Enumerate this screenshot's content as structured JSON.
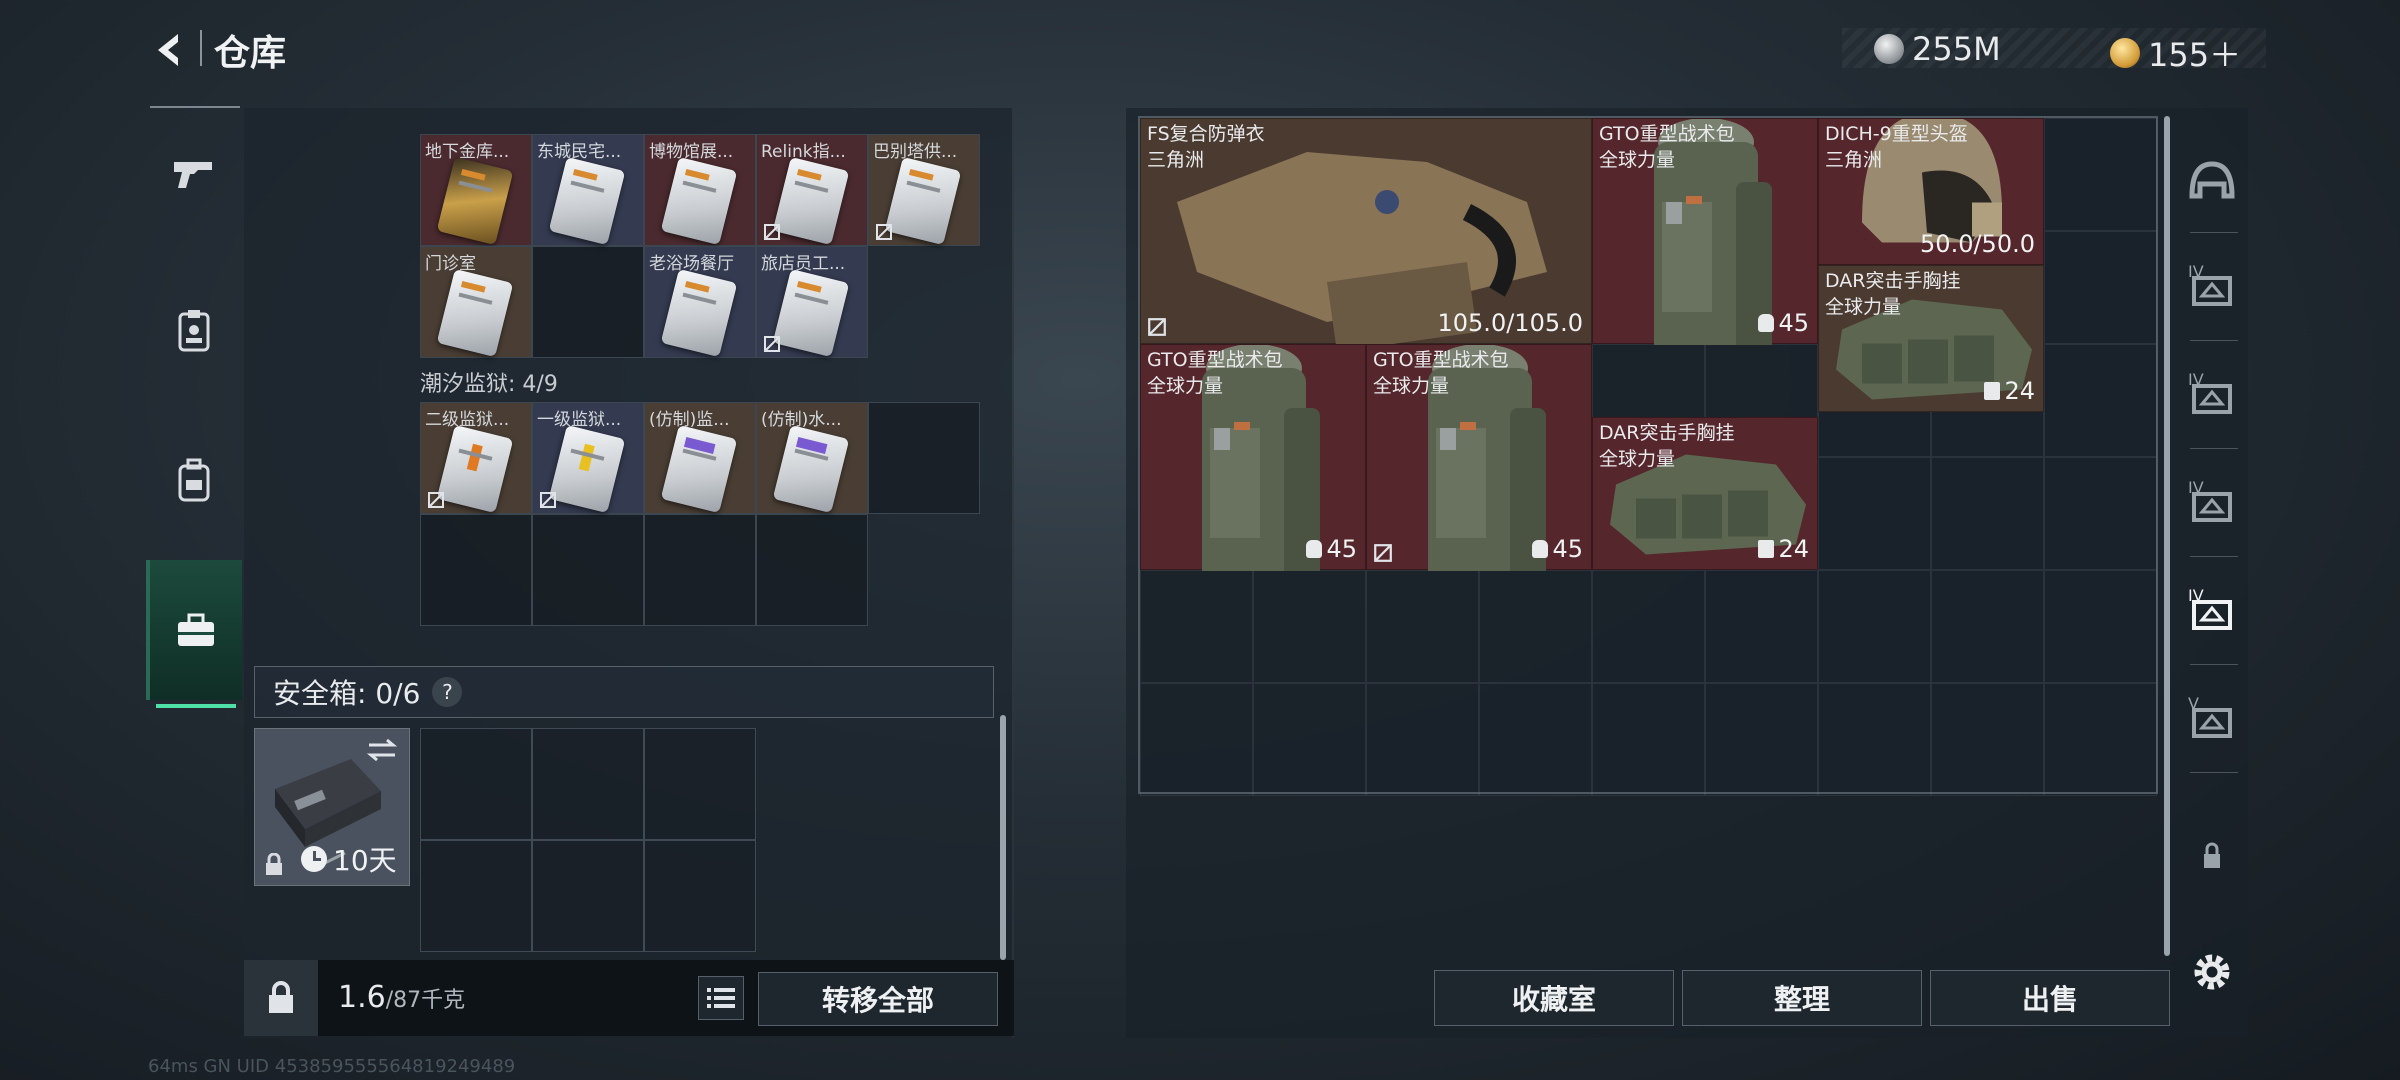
{
  "header": {
    "title": "仓库",
    "currencies": [
      {
        "icon": "silver-coin-icon",
        "value": "255M"
      },
      {
        "icon": "gold-coin-icon",
        "value": "155＋"
      }
    ]
  },
  "left_nav": {
    "items": [
      {
        "icon": "gun-icon",
        "active": false
      },
      {
        "icon": "id-badge-icon",
        "active": false
      },
      {
        "icon": "backpack-icon",
        "active": false
      },
      {
        "icon": "briefcase-icon",
        "active": true
      }
    ]
  },
  "left_panel": {
    "section1": {
      "cards": [
        {
          "name": "地下金库...",
          "bg": "red",
          "style": "gold",
          "no_extract": false
        },
        {
          "name": "东城民宅...",
          "bg": "blue",
          "style": "white",
          "no_extract": false
        },
        {
          "name": "博物馆展...",
          "bg": "red",
          "style": "white",
          "no_extract": false
        },
        {
          "name": "Relink指...",
          "bg": "red",
          "style": "white",
          "no_extract": true
        },
        {
          "name": "巴别塔供...",
          "bg": "brown",
          "style": "white",
          "no_extract": true
        },
        {
          "name": "门诊室",
          "bg": "brown",
          "style": "white",
          "no_extract": false
        },
        {
          "name": "老浴场餐厅",
          "bg": "blue",
          "style": "white",
          "no_extract": false
        },
        {
          "name": "旅店员工...",
          "bg": "blue",
          "style": "white",
          "no_extract": true
        }
      ]
    },
    "section2": {
      "label": "潮汐监狱: 4/9",
      "cards": [
        {
          "name": "二级监狱...",
          "bg": "brown",
          "style": "orange",
          "no_extract": true
        },
        {
          "name": "一级监狱...",
          "bg": "blue",
          "style": "yellow",
          "no_extract": true
        },
        {
          "name": "(仿制)监...",
          "bg": "brown",
          "style": "purple",
          "no_extract": false
        },
        {
          "name": "(仿制)水...",
          "bg": "brown",
          "style": "purple",
          "no_extract": false
        }
      ]
    },
    "safebox": {
      "label": "安全箱: 0/6",
      "help": "?",
      "duration": "10天"
    },
    "bottom": {
      "weight_current": "1.6",
      "weight_max": "/87千克",
      "transfer_all": "转移全部"
    }
  },
  "stash": {
    "items": [
      {
        "name": "FS复合防弹衣",
        "org": "三角洲",
        "value": "105.0/105.0",
        "value_icon": "",
        "color": "brown",
        "type": "vest",
        "no_extract": true
      },
      {
        "name": "GTO重型战术包",
        "org": "全球力量",
        "value": "45",
        "value_icon": "pack-icon",
        "color": "red",
        "type": "backpack",
        "no_extract": false
      },
      {
        "name": "DICH-9重型头盔",
        "org": "三角洲",
        "value": "50.0/50.0",
        "value_icon": "",
        "color": "red",
        "type": "helmet",
        "no_extract": false
      },
      {
        "name": "DAR突击手胸挂",
        "org": "全球力量",
        "value": "24",
        "value_icon": "vest-icon",
        "color": "brown",
        "type": "rig",
        "no_extract": false
      },
      {
        "name": "GTO重型战术包",
        "org": "全球力量",
        "value": "45",
        "value_icon": "pack-icon",
        "color": "red",
        "type": "backpack",
        "no_extract": false
      },
      {
        "name": "GTO重型战术包",
        "org": "全球力量",
        "value": "45",
        "value_icon": "pack-icon",
        "color": "red",
        "type": "backpack",
        "no_extract": true
      },
      {
        "name": "DAR突击手胸挂",
        "org": "全球力量",
        "value": "24",
        "value_icon": "vest-icon",
        "color": "red",
        "type": "rig",
        "no_extract": false
      }
    ]
  },
  "right_buttons": {
    "collection": "收藏室",
    "organize": "整理",
    "sell": "出售"
  },
  "right_nav": {
    "items": [
      {
        "icon": "helmet-icon",
        "tier": ""
      },
      {
        "icon": "armor-tier-icon",
        "tier": "IV"
      },
      {
        "icon": "armor-tier-icon",
        "tier": "IV"
      },
      {
        "icon": "armor-tier-icon",
        "tier": "IV"
      },
      {
        "icon": "armor-tier-icon",
        "tier": "IV"
      },
      {
        "icon": "armor-tier-icon",
        "tier": "V"
      },
      {
        "icon": "lock-icon",
        "tier": ""
      },
      {
        "icon": "gear-icon",
        "tier": ""
      }
    ]
  },
  "footer": {
    "text": "64ms   GN UID 453859555564819249489"
  },
  "colors": {
    "accent_green": "#4fe0a8",
    "item_red": "#55262c",
    "item_brown": "#4a3a30"
  }
}
